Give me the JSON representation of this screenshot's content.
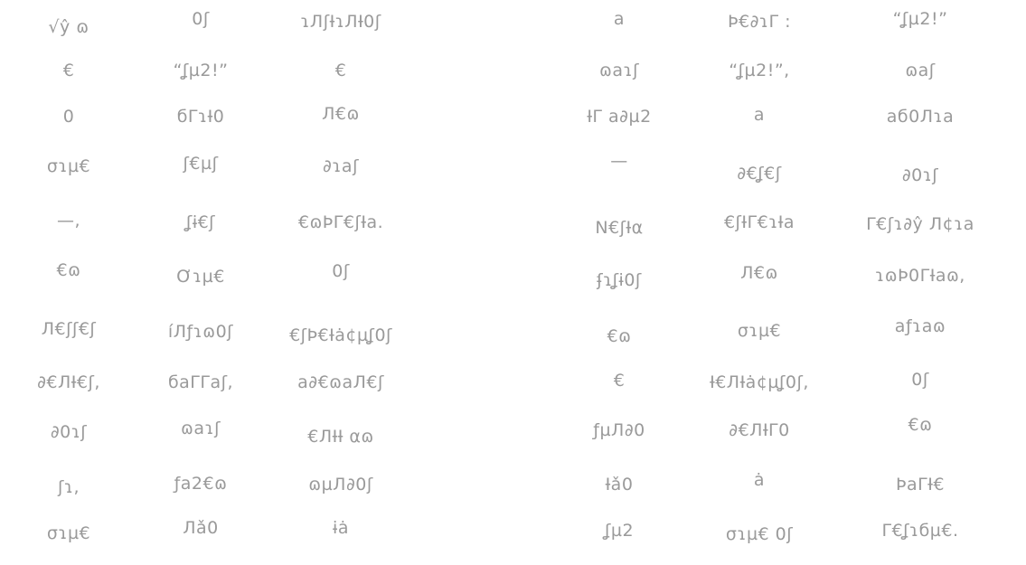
{
  "left_block": {
    "rows": [
      [
        "√ŷ ɷ",
        "0ʃ",
        "ɿЛʃƗɿЛƗ0ʃ"
      ],
      [
        "€",
        "“ʆµ2!”",
        "€"
      ],
      [
        "0",
        "бΓɿƗ0",
        "Л€ɷ"
      ],
      [
        "σɿµ€",
        "ʃ€µʃ",
        "∂ɿaʃ"
      ],
      [
        "—,",
        "ʆɨ€ʃ",
        "€ɷÞΓ€ʃƗa."
      ],
      [
        "€ɷ",
        "Ơɿµ€",
        "0ʃ"
      ],
      [
        "Л€ʃʃ€ʃ",
        "íЛƒɿɷ0ʃ",
        "€ʃÞ€Ɨȧ¢µʆ0ʃ"
      ],
      [
        "∂€ЛƗ€ʃ,",
        "бaΓΓaʃ,",
        "a∂€ɷaЛ€ʃ"
      ],
      [
        "∂0ɿʃ",
        "ɷaɿʃ",
        "€ЛƗƗ αɷ"
      ],
      [
        "ʃɿ,",
        "ƒa2€ɷ",
        "ɷµЛ∂0ʃ"
      ],
      [
        "σɿµ€",
        "Лǎ0",
        "ɨȧ"
      ]
    ]
  },
  "right_block": {
    "rows": [
      [
        "a",
        "Þ€∂ɿΓ :",
        "“ʆµ2!”"
      ],
      [
        "ɷaɿʃ",
        "“ʆµ2!”,",
        "ɷaʃ"
      ],
      [
        "ƗΓ a∂µ2",
        "a",
        "aб0Лɿa"
      ],
      [
        "—",
        "∂€ʆ€ʃ",
        "∂0ɿʃ"
      ],
      [
        "N€ʃƗα",
        "€ʃƗΓ€ɿƗa",
        "Γ€ʃɿ∂ŷ Л¢ɿa"
      ],
      [
        "ʄɿʆɨ0ʃ",
        "Л€ɷ",
        "ɿɷÞ0ΓƗaɷ,"
      ],
      [
        "€ɷ",
        "σɿµ€",
        "aƒɿaɷ"
      ],
      [
        "€",
        "Ɨ€ЛƗȧ¢µʆ0ʃ,",
        "0ʃ"
      ],
      [
        "ƒµЛ∂0",
        "∂€ЛƗΓ0",
        "€ɷ"
      ],
      [
        "Ɨǎ0",
        "ȧ",
        "ÞaΓƗ€"
      ],
      [
        "ʆµ2",
        "σɿµ€ 0ʃ",
        "Γ€ʆɿбµ€."
      ]
    ]
  },
  "colors": {
    "text": "#9a9a9a",
    "background": "#ffffff"
  }
}
